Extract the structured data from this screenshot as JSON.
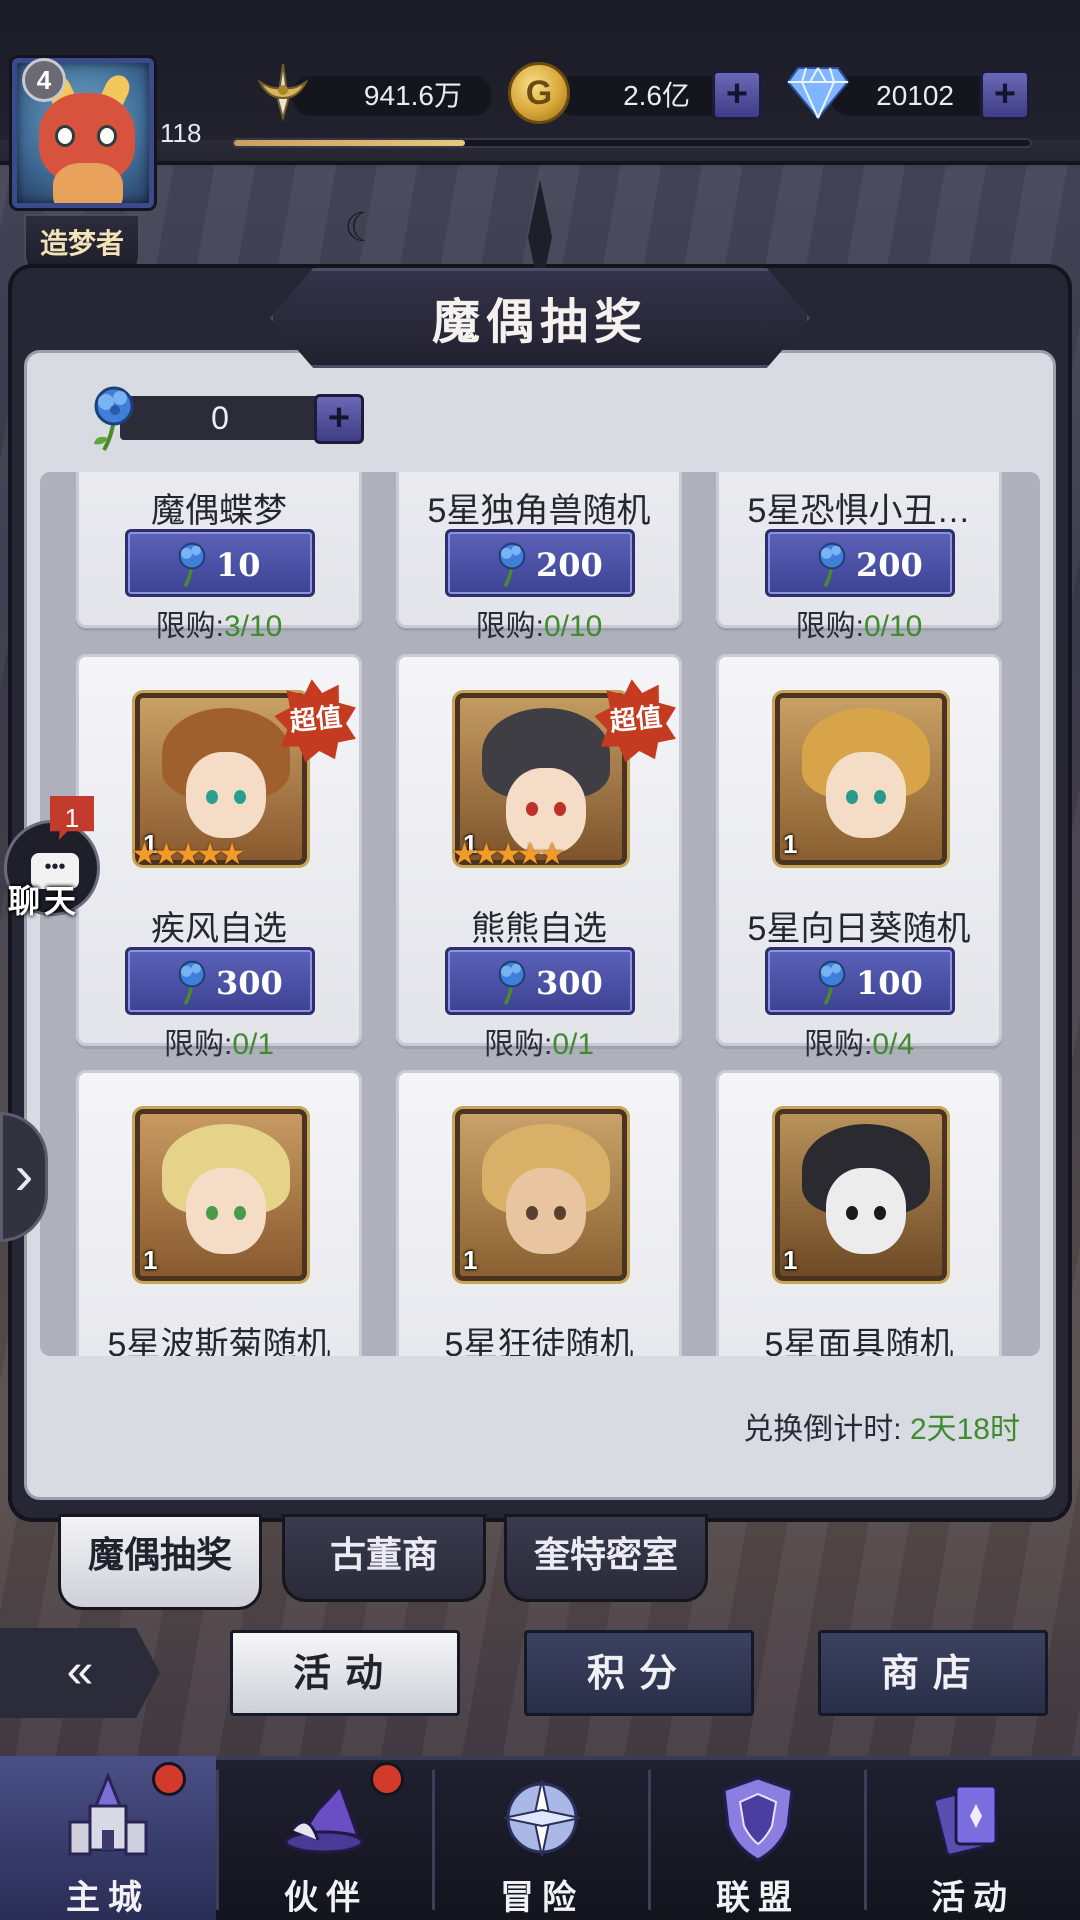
{
  "header": {
    "level": "4",
    "rank_title": "造梦者",
    "rank_stars": "♦♦♦♦",
    "xp_level": "118",
    "xp_progress": 0.29,
    "power": "941.6万",
    "gold": "2.6亿",
    "diamonds": "20102",
    "plus": "+"
  },
  "panel": {
    "title": "魔偶抽奖",
    "flower_balance": "0",
    "deadline_label": "兑换倒计时:",
    "deadline_value": "2天18时"
  },
  "items": [
    {
      "name": "魔偶蝶梦",
      "price": "10",
      "limit_label": "限购:",
      "limit": "3/10"
    },
    {
      "name": "5星独角兽随机",
      "price": "200",
      "limit_label": "限购:",
      "limit": "0/10"
    },
    {
      "name": "5星恐惧小丑…",
      "price": "200",
      "limit_label": "限购:",
      "limit": "0/10"
    },
    {
      "name": "疾风自选",
      "price": "300",
      "limit_label": "限购:",
      "limit": "0/1",
      "badge": "超值",
      "copies": "1",
      "stars": "★★★★★"
    },
    {
      "name": "熊熊自选",
      "price": "300",
      "limit_label": "限购:",
      "limit": "0/1",
      "badge": "超值",
      "copies": "1",
      "stars": "★★★★★"
    },
    {
      "name": "5星向日葵随机",
      "price": "100",
      "limit_label": "限购:",
      "limit": "0/4",
      "copies": "1"
    },
    {
      "name": "5星波斯菊随机",
      "copies": "1"
    },
    {
      "name": "5星狂徒随机",
      "copies": "1"
    },
    {
      "name": "5星面具随机",
      "copies": "1"
    }
  ],
  "chat": {
    "label": "聊天",
    "count": "1"
  },
  "sub_tabs": [
    "魔偶抽奖",
    "古董商",
    "奎特密室"
  ],
  "categories": [
    "活动",
    "积分",
    "商店"
  ],
  "nav": [
    "主城",
    "伙伴",
    "冒险",
    "联盟",
    "活动"
  ],
  "colors": {
    "accent": "#4a4f86",
    "limit_green": "#3f8c2e",
    "price_blue": "#3d4293"
  }
}
